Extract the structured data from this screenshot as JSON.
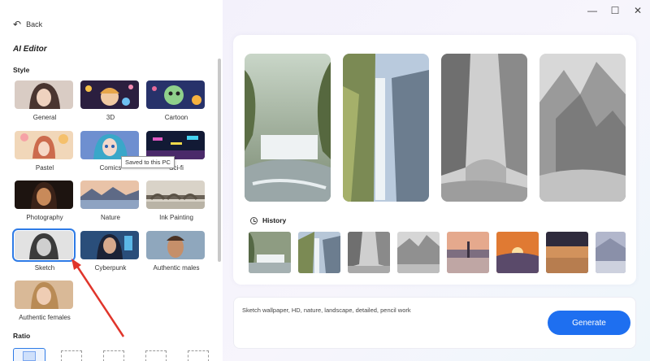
{
  "window": {
    "minimize_icon": "minimize-icon",
    "maximize_icon": "maximize-icon",
    "close_icon": "close-icon"
  },
  "sidebar": {
    "back_label": "Back",
    "editor_title": "AI Editor",
    "style_section": "Style",
    "ratio_section": "Ratio",
    "styles": [
      {
        "label": "General"
      },
      {
        "label": "3D"
      },
      {
        "label": "Cartoon"
      },
      {
        "label": "Pastel"
      },
      {
        "label": "Comics"
      },
      {
        "label": "Sci-fi"
      },
      {
        "label": "Photography"
      },
      {
        "label": "Nature"
      },
      {
        "label": "Ink Painting"
      },
      {
        "label": "Sketch"
      },
      {
        "label": "Cyberpunk"
      },
      {
        "label": "Authentic males"
      },
      {
        "label": "Authentic females"
      }
    ],
    "selected_style": "Sketch",
    "tooltip": "Saved to this PC"
  },
  "main": {
    "history_label": "History",
    "prompt_text": "Sketch wallpaper, HD, nature, landscape, detailed, pencil work",
    "generate_label": "Generate"
  },
  "colors": {
    "accent": "#1e6ff0",
    "selection": "#2e7be6",
    "annotation_arrow": "#e0352b"
  }
}
